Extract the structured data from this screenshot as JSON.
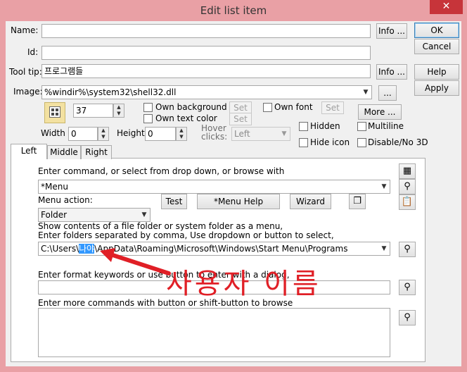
{
  "window": {
    "title": "Edit list item",
    "close_label": "✕"
  },
  "fields": {
    "name_label": "Name:",
    "name_value": "",
    "id_label": "Id:",
    "id_value": "",
    "tooltip_label": "Tool tip:",
    "tooltip_value": "프로그램들",
    "image_label": "Image:",
    "image_value": "%windir%\\system32\\shell32.dll",
    "icon_index": "37",
    "width_label": "Width",
    "width_value": "0",
    "height_label": "Height",
    "height_value": "0",
    "hover_label_1": "Hover",
    "hover_label_2": "clicks:",
    "hover_value": "Left"
  },
  "buttons": {
    "ok": "OK",
    "cancel": "Cancel",
    "help": "Help",
    "apply": "Apply",
    "info_name": "Info ...",
    "info_tooltip": "Info ...",
    "image_browse": "...",
    "more": "More ...",
    "set_bg": "Set",
    "set_text": "Set",
    "set_font": "Set",
    "test": "Test",
    "menu_help": "*Menu Help",
    "wizard": "Wizard"
  },
  "checks": {
    "own_background": "Own background",
    "own_text_color": "Own text color",
    "own_font": "Own font",
    "hidden": "Hidden",
    "multiline": "Multiline",
    "hide_icon": "Hide icon",
    "disable_no_3d": "Disable/No 3D"
  },
  "tabs": [
    "Left",
    "Middle",
    "Right"
  ],
  "panel": {
    "command_label": "Enter command, or select from drop down, or browse with",
    "command_value": "*Menu",
    "menu_action_label": "Menu action:",
    "action_value": "Folder",
    "folder_desc_1": "Show contents of a file folder or system folder as a menu,",
    "folder_desc_2": "Enter folders separated by comma,  Use dropdown or button to select,",
    "path_prefix": "C:\\Users\\",
    "path_user": "나야",
    "path_suffix": "\\AppData\\Roaming\\Microsoft\\Windows\\Start Menu\\Programs",
    "format_label": "Enter format keywords or use button to enter with a dialog,",
    "format_value": "",
    "more_commands_label": "Enter more commands with button or shift-button to browse",
    "more_commands_value": ""
  },
  "annotation": {
    "text": "사용자 이름",
    "color": "#e01f26"
  }
}
